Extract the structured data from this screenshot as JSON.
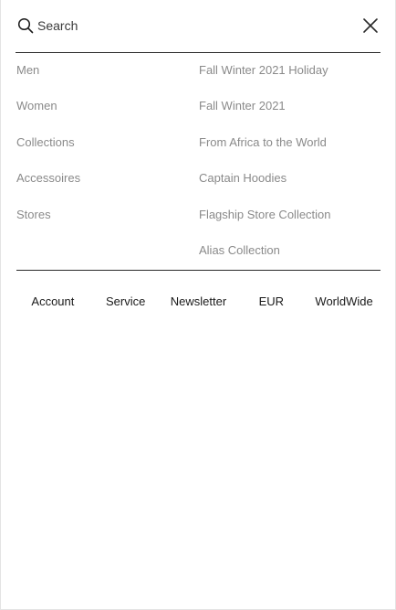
{
  "search": {
    "placeholder": "Search",
    "value": "",
    "icon": "search-icon"
  },
  "close": {
    "icon": "close-icon"
  },
  "menu_left": [
    {
      "label": "Men"
    },
    {
      "label": "Women"
    },
    {
      "label": "Collections"
    },
    {
      "label": "Accessoires"
    },
    {
      "label": "Stores"
    }
  ],
  "menu_right": [
    {
      "label": "Fall Winter 2021 Holiday"
    },
    {
      "label": "Fall Winter 2021"
    },
    {
      "label": "From Africa to the World"
    },
    {
      "label": "Captain Hoodies"
    },
    {
      "label": "Flagship Store Collection"
    },
    {
      "label": "Alias Collection"
    }
  ],
  "footer": [
    {
      "label": "Account"
    },
    {
      "label": "Service"
    },
    {
      "label": "Newsletter"
    },
    {
      "label": "EUR"
    },
    {
      "label": "WorldWide"
    }
  ],
  "colors": {
    "text_dark": "#1a1a1a",
    "text_muted": "#8a8a8a",
    "divider": "#2a2a2a",
    "background": "#ffffff"
  }
}
